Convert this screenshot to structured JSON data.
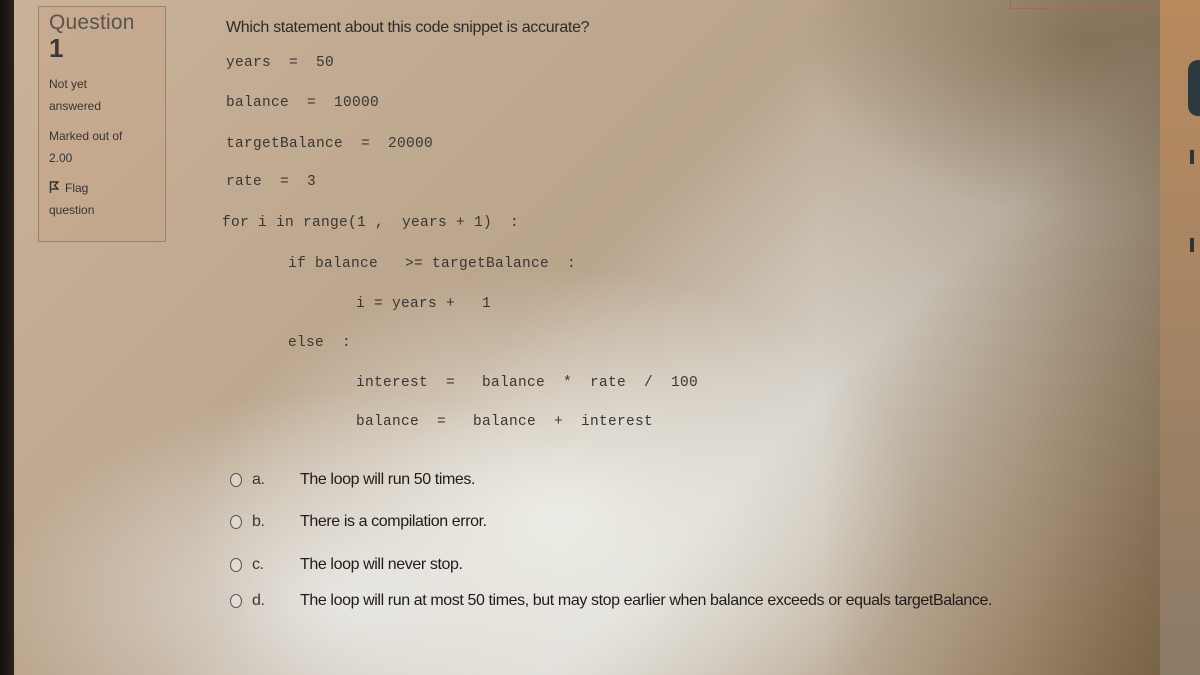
{
  "question_info": {
    "label": "Question",
    "number": "1",
    "state": [
      "Not yet",
      "answered"
    ],
    "grade": [
      "Marked out of",
      "2.00"
    ],
    "flag": [
      "Flag",
      "question"
    ]
  },
  "question": {
    "prompt": "Which statement about this code snippet is accurate?",
    "code_lines": [
      "years  =  50",
      "balance  =  10000",
      "targetBalance  =  20000",
      "rate  =  3",
      "for i in range(1 ,  years + 1)  :",
      "if balance   >= targetBalance  :",
      "i = years +   1",
      "else  :",
      "interest  =   balance  *  rate  /  100",
      "balance  =   balance  +  interest"
    ]
  },
  "options": [
    {
      "letter": "a.",
      "text": "The loop will run 50 times.",
      "selected": false
    },
    {
      "letter": "b.",
      "text": "There is a compilation error.",
      "selected": false
    },
    {
      "letter": "c.",
      "text": "The loop will never stop.",
      "selected": false
    },
    {
      "letter": "d.",
      "text": "The loop will run at most 50 times, but may stop earlier when balance exceeds or equals targetBalance.",
      "selected": false
    }
  ]
}
